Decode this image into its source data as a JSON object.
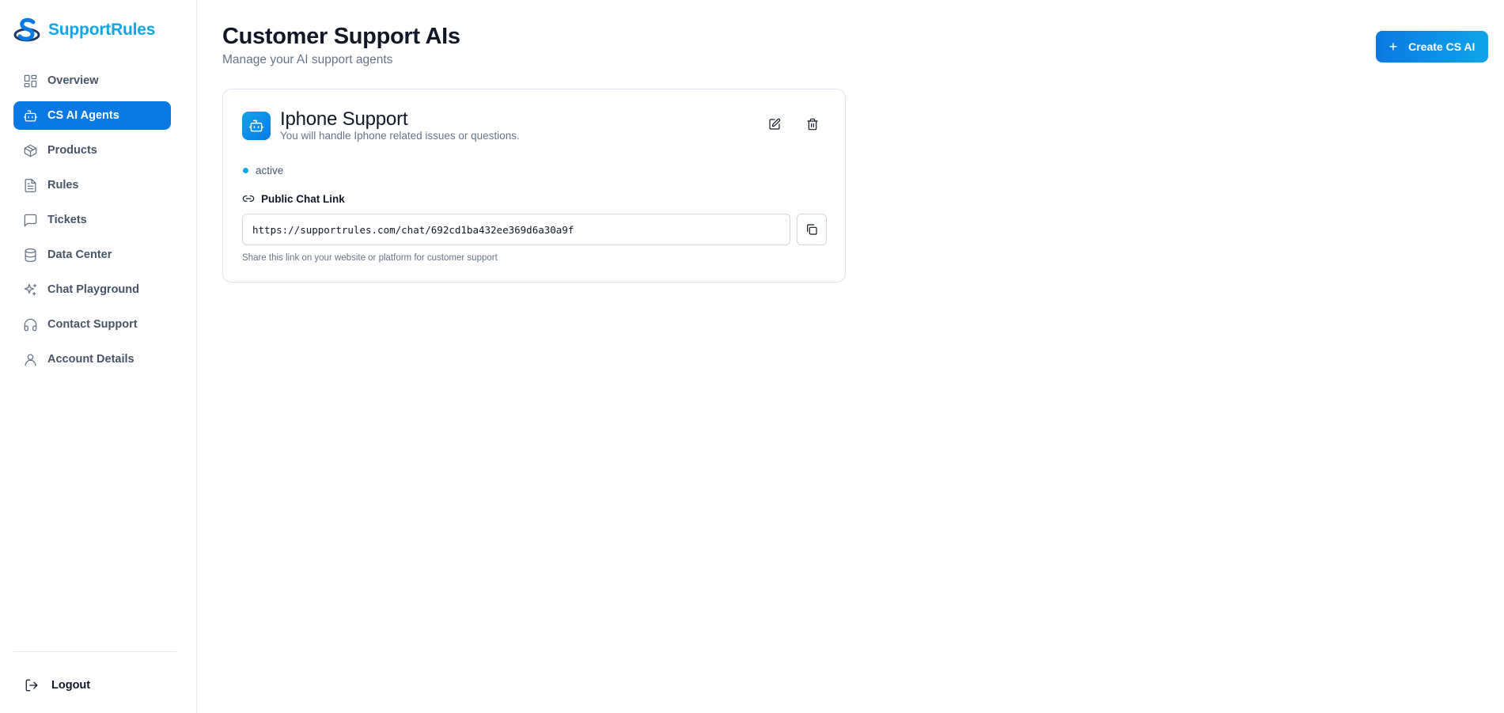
{
  "brand": {
    "name": "SupportRules",
    "accent": "#0ea5e9",
    "primary": "#0b79e3"
  },
  "sidebar": {
    "items": [
      {
        "label": "Overview",
        "icon": "grid-icon"
      },
      {
        "label": "CS AI Agents",
        "icon": "bot-icon",
        "active": true
      },
      {
        "label": "Products",
        "icon": "box-icon"
      },
      {
        "label": "Rules",
        "icon": "file-text-icon"
      },
      {
        "label": "Tickets",
        "icon": "message-square-icon"
      },
      {
        "label": "Data Center",
        "icon": "database-icon"
      },
      {
        "label": "Chat Playground",
        "icon": "sparkles-icon"
      },
      {
        "label": "Contact Support",
        "icon": "headphones-icon"
      },
      {
        "label": "Account Details",
        "icon": "user-icon"
      }
    ],
    "logout_label": "Logout"
  },
  "header": {
    "title": "Customer Support AIs",
    "subtitle": "Manage your AI support agents",
    "create_label": "Create CS AI"
  },
  "agent": {
    "name": "Iphone Support",
    "description": "You will handle Iphone related issues or questions.",
    "status": "active",
    "status_color": "#0ea5e9",
    "link_label": "Public Chat Link",
    "link_value": "https://supportrules.com/chat/692cd1ba432ee369d6a30a9f",
    "link_help": "Share this link on your website or platform for customer support"
  }
}
